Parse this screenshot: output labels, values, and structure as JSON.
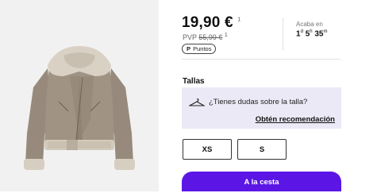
{
  "product": {
    "price": "19,90 €",
    "price_mark": "1",
    "pvp_label": "PVP",
    "pvp_old_price": "55,99 €",
    "pvp_mark": "1",
    "points_label": "Puntos",
    "points_icon": "P"
  },
  "countdown": {
    "label": "Acaba en",
    "days": "1",
    "days_unit": "d",
    "hours": "5",
    "hours_unit": "h",
    "minutes": "35",
    "minutes_unit": "m"
  },
  "sizes": {
    "title": "Tallas",
    "help_question": "¿Tienes dudas sobre la talla?",
    "help_link": "Obtén recomendación",
    "options": [
      "XS",
      "S"
    ]
  },
  "cart": {
    "button_label": "A la cesta",
    "color": "#5b16e6"
  },
  "icons": {
    "hanger": "hanger-icon"
  }
}
